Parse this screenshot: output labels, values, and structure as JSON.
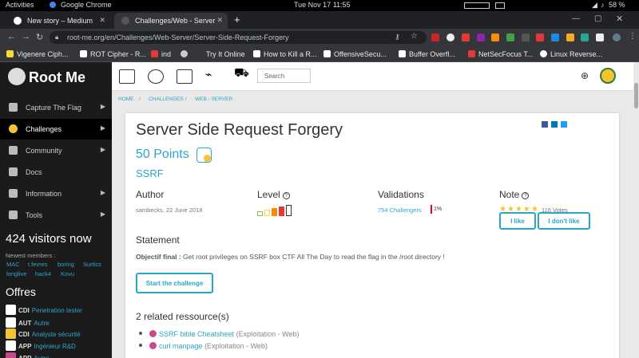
{
  "os": {
    "activities": "Activities",
    "app_name": "Google Chrome",
    "clock": "Tue Nov 17  11:55",
    "battery": "58 %"
  },
  "browser": {
    "tabs": [
      {
        "label": "New story – Medium",
        "active": false
      },
      {
        "label": "Challenges/Web - Server",
        "active": true
      }
    ],
    "new_tab": "+",
    "url": "root-me.org/en/Challenges/Web-Server/Server-Side-Request-Forgery",
    "bookmarks": [
      "Vigenere Ciph...",
      "ROT Cipher - R...",
      "ind",
      "Try It Online",
      "How to Kill a R...",
      "OffensiveSecu...",
      "Buffer Overfl...",
      "NetSecFocus T...",
      "Linux Reverse..."
    ]
  },
  "site": {
    "logo_text": "Root Me",
    "search_placeholder": "Search",
    "sidebar": {
      "items": [
        {
          "label": "Capture The Flag",
          "icon": "flag-icon"
        },
        {
          "label": "Challenges",
          "icon": "challenge-icon"
        },
        {
          "label": "Community",
          "icon": "community-icon"
        },
        {
          "label": "Docs",
          "icon": "docs-icon"
        },
        {
          "label": "Information",
          "icon": "info-icon"
        },
        {
          "label": "Tools",
          "icon": "tools-icon"
        }
      ],
      "visitors": "424 visitors now",
      "newest_label": "Newest members :",
      "members": [
        "MAC",
        "t.fevres",
        "boring",
        "Surtics",
        "longlive",
        "hack4",
        "Kovu"
      ],
      "offres_title": "Offres",
      "offers": [
        {
          "kind": "CDI",
          "role": "Penetration tester"
        },
        {
          "kind": "AUT",
          "role": "Autre"
        },
        {
          "kind": "CDI",
          "role": "Analyste sécurité"
        },
        {
          "kind": "APP",
          "role": "Ingénieur R&D"
        },
        {
          "kind": "APP",
          "role": "Autre"
        }
      ]
    },
    "breadcrumb": [
      "HOME",
      "CHALLENGES",
      "WEB - SERVER"
    ]
  },
  "challenge": {
    "title": "Server Side Request Forgery",
    "points": "50 Points",
    "category": "SSRF",
    "author_label": "Author",
    "author": "sambecks,  22 June 2018",
    "level_label": "Level",
    "level": 4,
    "validations_label": "Validations",
    "validations": "754 Challengers",
    "validations_pct": "1%",
    "note_label": "Note",
    "votes": "116 Votes",
    "stars": 5,
    "like_label": "I like",
    "dislike_label": "I don't like",
    "statement_label": "Statement",
    "statement_bold": "Objectif final :",
    "statement_text": " Get root privileges on SSRF box CTF All The Day to read the flag in the /root directory !",
    "start_label": "Start the challenge",
    "related_label": "2 related ressource(s)",
    "resources": [
      {
        "title": "SSRF bible Cheatsheet",
        "type": "(Exploitation - Web)"
      },
      {
        "title": "curl manpage",
        "type": "(Exploitation - Web)"
      }
    ]
  },
  "colors": {
    "accent": "#2ba6cb",
    "sidebar": "#1b1b1b"
  }
}
